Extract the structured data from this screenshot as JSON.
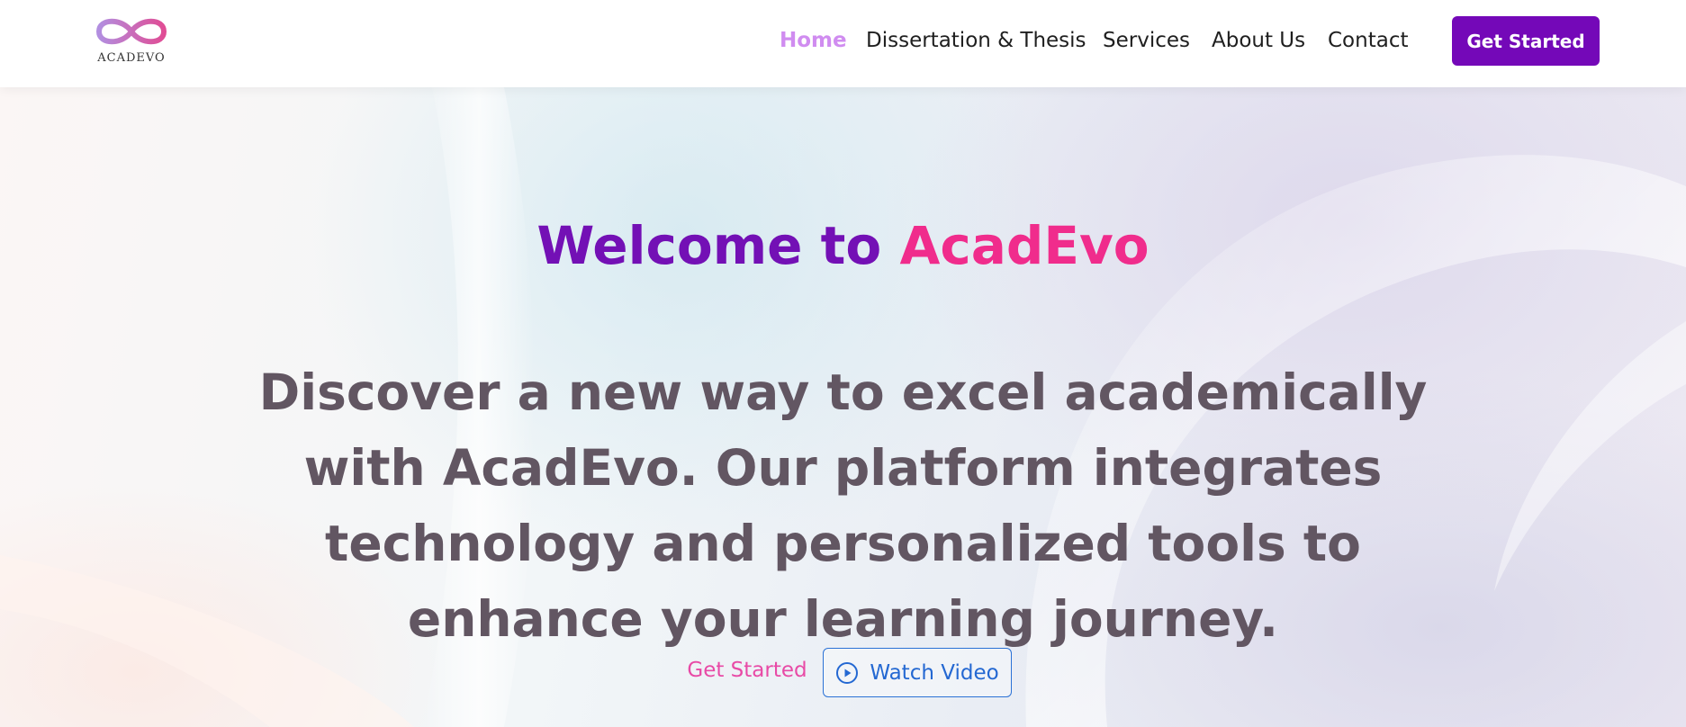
{
  "brand": {
    "logo_text": "ACADEVO",
    "accent": "#7408b8",
    "pink": "#f02c8c",
    "gradient_from": "#b28ee0",
    "gradient_to": "#e04d95"
  },
  "nav": {
    "items": [
      {
        "label": "Home",
        "active": true
      },
      {
        "label": "Dissertation & Thesis",
        "active": false
      },
      {
        "label": "Services",
        "active": false
      },
      {
        "label": "About Us",
        "active": false
      },
      {
        "label": "Contact",
        "active": false
      }
    ],
    "cta_label": "Get Started"
  },
  "hero": {
    "headline_part1": "Welcome to ",
    "headline_part2": "AcadEvo",
    "subtext": "Discover a new way to excel academically with AcadEvo. Our platform integrates technology and personalized tools to enhance your learning journey.",
    "cta_label": "Get Started",
    "video_label": "Watch Video",
    "video_icon": "play-circle-icon"
  }
}
